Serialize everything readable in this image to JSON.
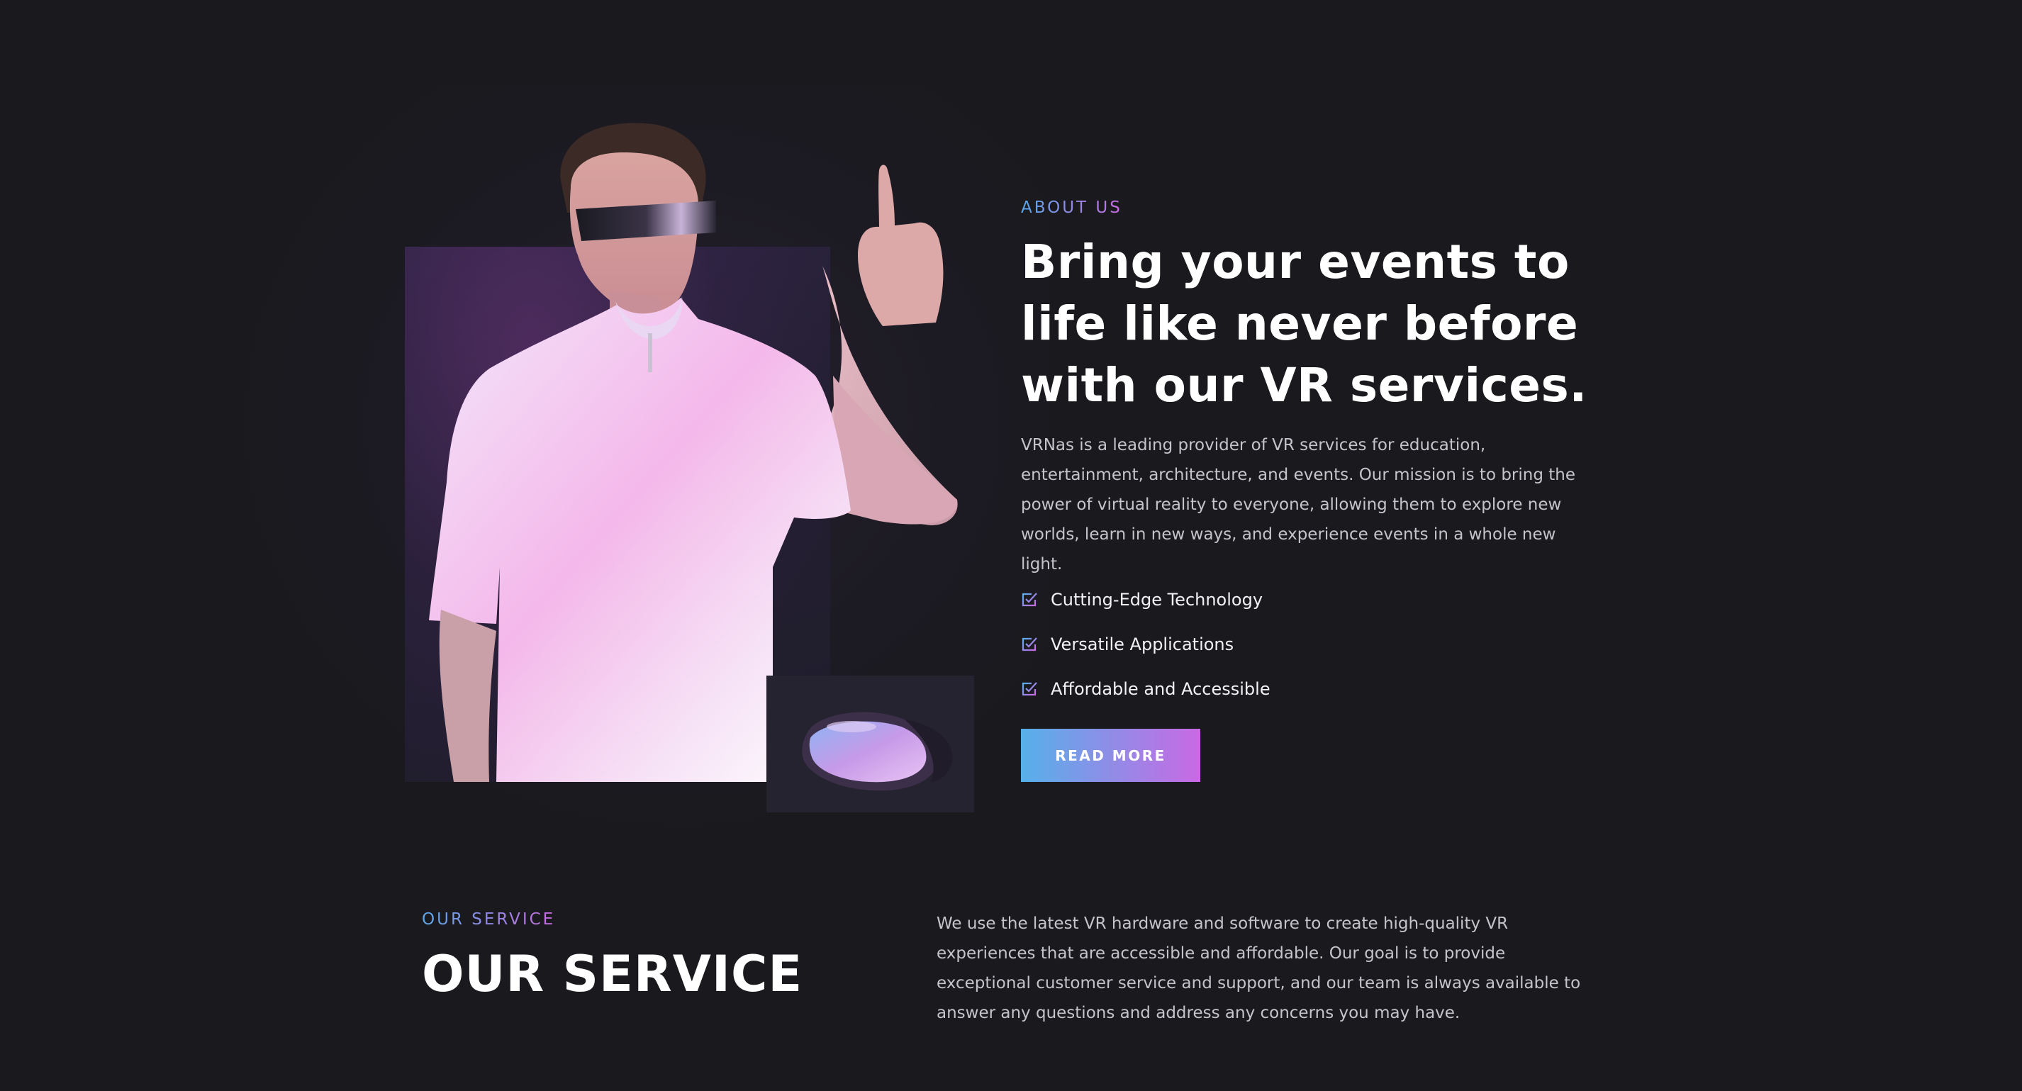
{
  "colors": {
    "background": "#1a1a1e",
    "accent_gradient_start": "#56b0ea",
    "accent_gradient_end": "#c969e3"
  },
  "about": {
    "eyebrow": "ABOUT US",
    "title": "Bring your events to life like never before with our VR services.",
    "description": "VRNas is a leading provider of VR services for education, entertainment, architecture, and events. Our mission is to bring the power of virtual reality to everyone, allowing them to explore new worlds, learn in new ways, and experience events in a whole new light.",
    "features": [
      {
        "icon": "checkbox-checked-icon",
        "label": "Cutting-Edge Technology"
      },
      {
        "icon": "checkbox-checked-icon",
        "label": "Versatile Applications"
      },
      {
        "icon": "checkbox-checked-icon",
        "label": "Affordable and Accessible"
      }
    ],
    "cta_label": "READ MORE"
  },
  "service": {
    "eyebrow": "OUR SERVICE",
    "title": "OUR SERVICE",
    "description": "We use the latest VR hardware and software to create high-quality VR experiences that are accessible and affordable. Our goal is to provide exceptional customer service and support, and our team is always available to answer any questions and address any concerns you may have."
  }
}
